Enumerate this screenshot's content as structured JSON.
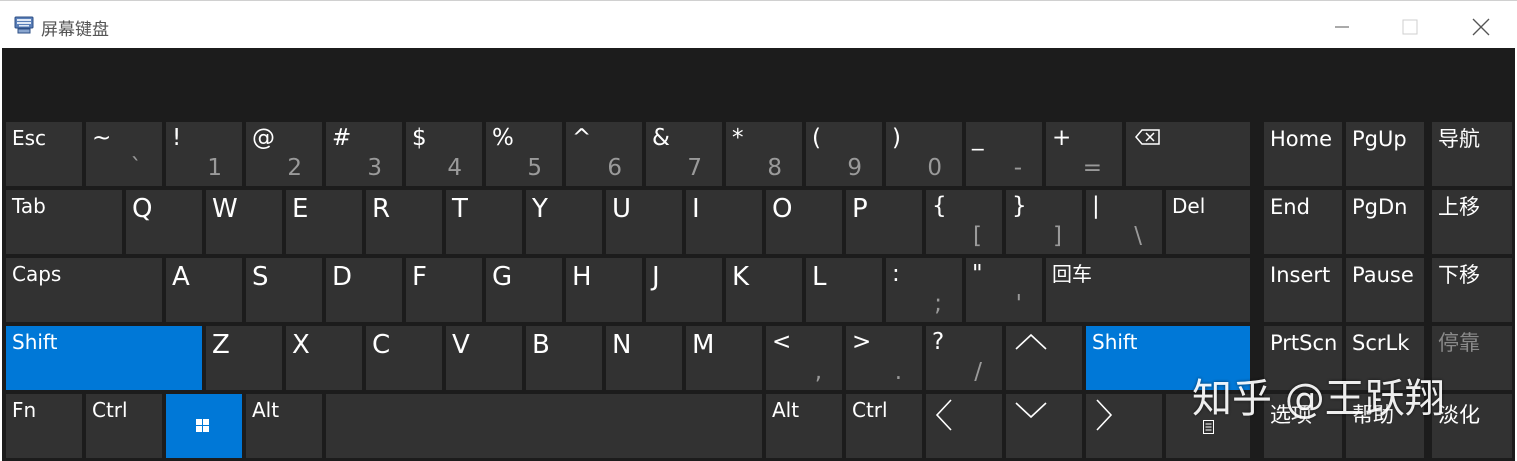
{
  "window": {
    "title": "屏幕键盘"
  },
  "keys": {
    "esc": "Esc",
    "tilde": {
      "top": "~",
      "bottom": "`"
    },
    "d1": {
      "top": "!",
      "bottom": "1"
    },
    "d2": {
      "top": "@",
      "bottom": "2"
    },
    "d3": {
      "top": "#",
      "bottom": "3"
    },
    "d4": {
      "top": "$",
      "bottom": "4"
    },
    "d5": {
      "top": "%",
      "bottom": "5"
    },
    "d6": {
      "top": "^",
      "bottom": "6"
    },
    "d7": {
      "top": "&",
      "bottom": "7"
    },
    "d8": {
      "top": "*",
      "bottom": "8"
    },
    "d9": {
      "top": "(",
      "bottom": "9"
    },
    "d0": {
      "top": ")",
      "bottom": "0"
    },
    "minus": {
      "top": "_",
      "bottom": "-"
    },
    "equal": {
      "top": "+",
      "bottom": "="
    },
    "tab": "Tab",
    "q": "Q",
    "w": "W",
    "e": "E",
    "r": "R",
    "t": "T",
    "y": "Y",
    "u": "U",
    "i": "I",
    "o": "O",
    "p": "P",
    "lbracket": {
      "top": "{",
      "bottom": "["
    },
    "rbracket": {
      "top": "}",
      "bottom": "]"
    },
    "backslash": {
      "top": "|",
      "bottom": "\\"
    },
    "del": "Del",
    "caps": "Caps",
    "a": "A",
    "s": "S",
    "d": "D",
    "f": "F",
    "g": "G",
    "h": "H",
    "j": "J",
    "k": "K",
    "l": "L",
    "semicolon": {
      "top": ":",
      "bottom": ";"
    },
    "quote": {
      "top": "\"",
      "bottom": "'"
    },
    "enter": "回车",
    "shift_left": "Shift",
    "z": "Z",
    "x": "X",
    "c": "C",
    "v": "V",
    "b": "B",
    "n": "N",
    "m": "M",
    "comma": {
      "top": "<",
      "bottom": ","
    },
    "period": {
      "top": ">",
      "bottom": "."
    },
    "slash": {
      "top": "?",
      "bottom": "/"
    },
    "shift_right": "Shift",
    "fn": "Fn",
    "ctrl_left": "Ctrl",
    "alt_left": "Alt",
    "alt_right": "Alt",
    "ctrl_right": "Ctrl",
    "home": "Home",
    "pgup": "PgUp",
    "nav": "导航",
    "end": "End",
    "pgdn": "PgDn",
    "moveup": "上移",
    "insert": "Insert",
    "pause": "Pause",
    "movedown": "下移",
    "prtscn": "PrtScn",
    "scrlk": "ScrLk",
    "dock": "停靠",
    "options": "选项",
    "help": "帮助",
    "fade": "淡化"
  },
  "watermark": "知乎 @王跃翔",
  "colors": {
    "key": "#323232",
    "keyboard_bg": "#1c1c1c",
    "active_key": "#0078d7",
    "dim_text": "#9a9a9a"
  }
}
